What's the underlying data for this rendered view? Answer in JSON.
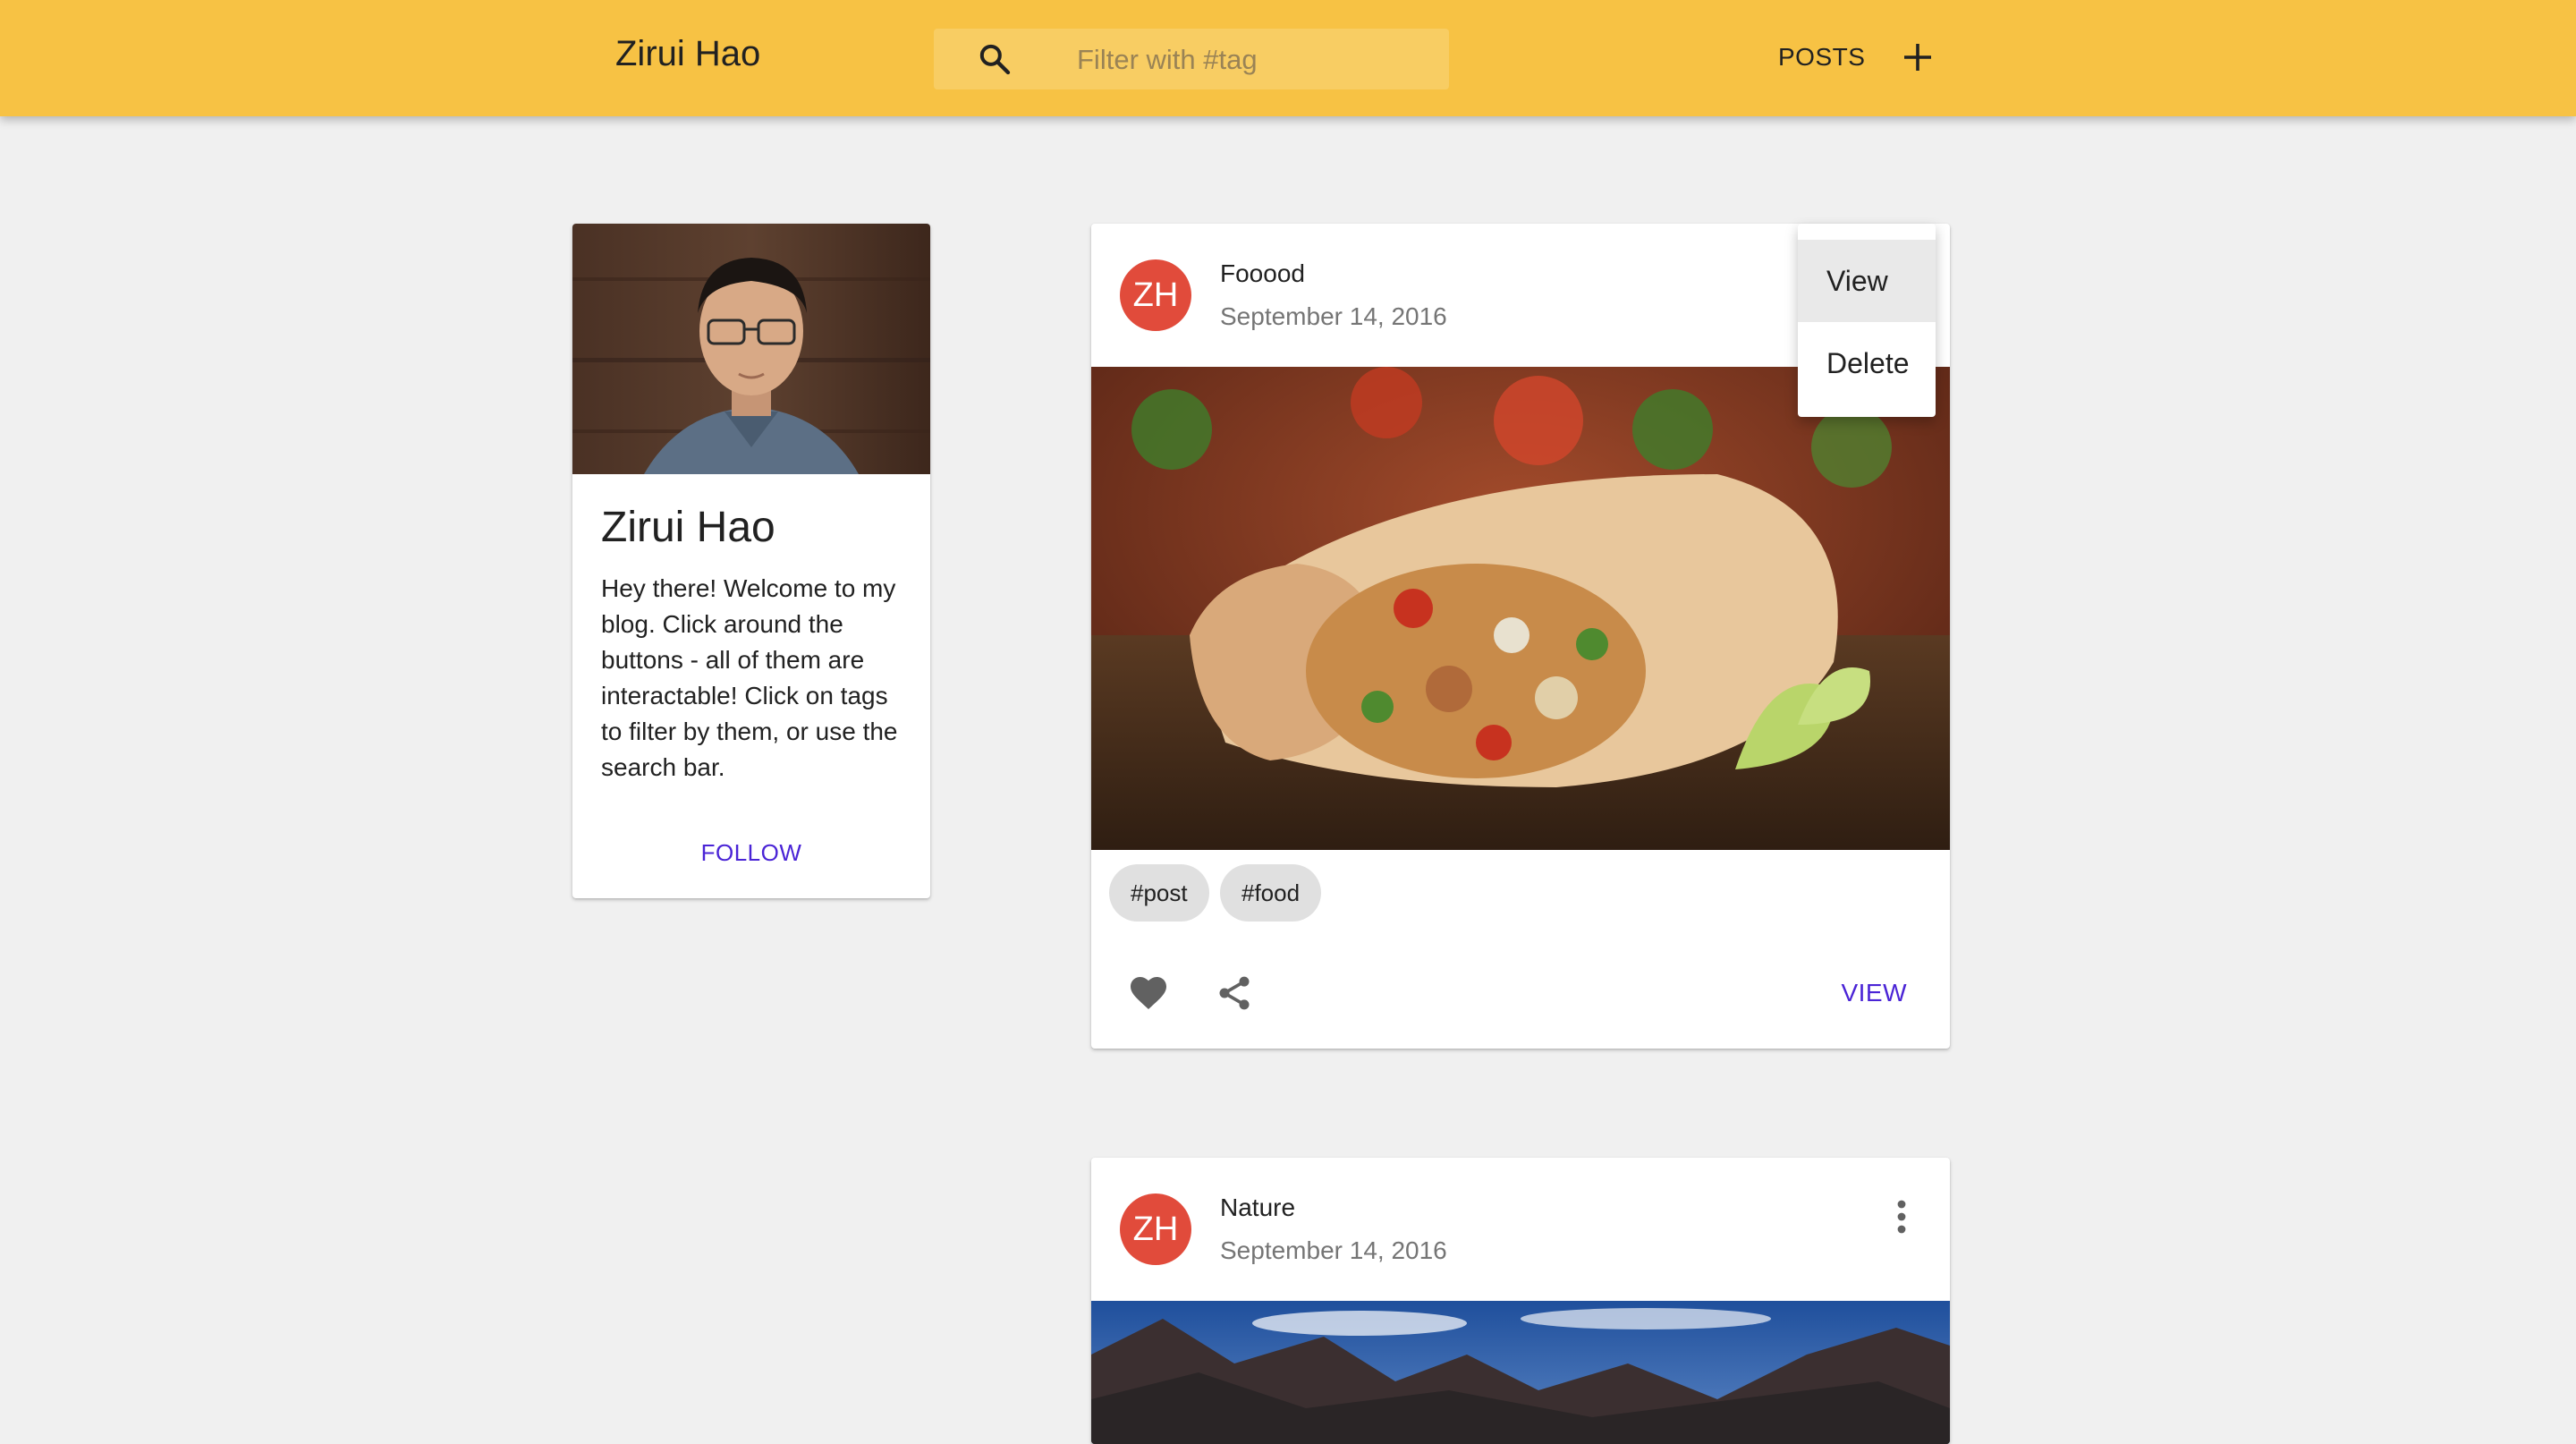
{
  "appbar": {
    "title": "Zirui Hao",
    "search_placeholder": "Filter with #tag",
    "search_icon": "search-icon",
    "posts_label": "POSTS",
    "add_icon": "add-icon",
    "background": "#f7c244"
  },
  "profile": {
    "name": "Zirui Hao",
    "bio": "Hey there! Welcome to my blog. Click around the buttons - all of them are interactable! Click on tags to filter by them, or use the search bar.",
    "follow_label": "FOLLOW"
  },
  "posts": [
    {
      "avatar": "ZH",
      "title": "Fooood",
      "date": "September 14, 2016",
      "tags": [
        "#post",
        "#food"
      ],
      "view_label": "VIEW",
      "like_icon": "heart-icon",
      "share_icon": "share-icon"
    },
    {
      "avatar": "ZH",
      "title": "Nature",
      "date": "September 14, 2016",
      "more_icon": "more-vert-icon"
    }
  ],
  "menu": {
    "items": [
      "View",
      "Delete"
    ],
    "highlighted": "View"
  },
  "colors": {
    "accent": "#4a24d6",
    "avatar": "#e14b3b",
    "background": "#f0f0f0"
  }
}
